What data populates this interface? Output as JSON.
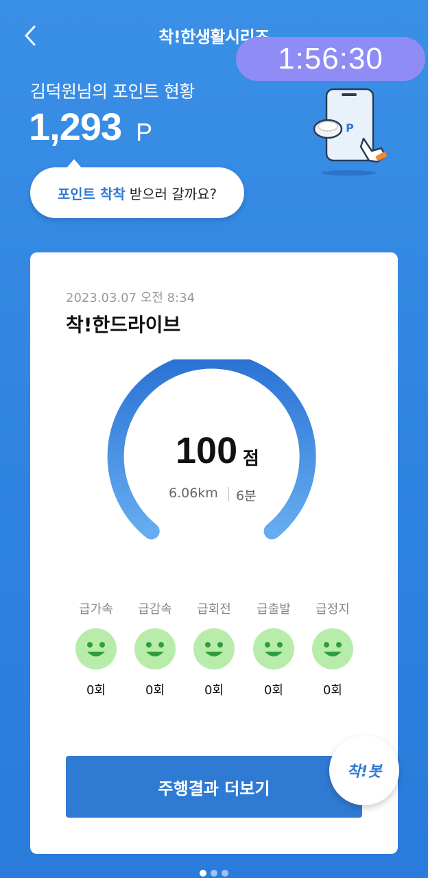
{
  "header": {
    "title": "착!한생활시리즈"
  },
  "timer": "1:56:30",
  "points": {
    "label": "김덕원님의 포인트 현황",
    "value": "1,293",
    "unit": "P"
  },
  "bubble": {
    "highlight": "포인트 착착",
    "text": "받으러 갈까요?"
  },
  "card": {
    "date": "2023.03.07 오전 8:34",
    "title": "착!한드라이브",
    "score": "100",
    "score_unit": "점",
    "distance": "6.06km",
    "duration": "6분",
    "score_fraction": 1.0,
    "events": [
      {
        "label": "급가속",
        "count": "0회"
      },
      {
        "label": "급감속",
        "count": "0회"
      },
      {
        "label": "급회전",
        "count": "0회"
      },
      {
        "label": "급출발",
        "count": "0회"
      },
      {
        "label": "급정지",
        "count": "0회"
      }
    ],
    "more_button": "주행결과 더보기"
  },
  "bot_button": "착!봇",
  "pager": {
    "count": 3,
    "active": 0
  },
  "colors": {
    "accent": "#2f7ad3",
    "timer_bg": "#8f8cf6",
    "face": "#b8ecaa"
  },
  "icons": {
    "back": "chevron-left-icon",
    "illustration": "phone-point-icon",
    "face": "smile-face-icon"
  }
}
